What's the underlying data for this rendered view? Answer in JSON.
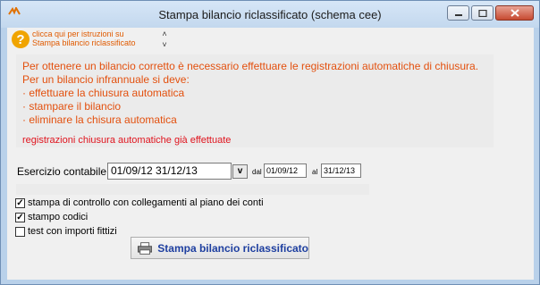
{
  "window": {
    "title": "Stampa bilancio riclassificato (schema cee)"
  },
  "help": {
    "line1": "clicca qui per istruzioni su",
    "line2": "Stampa bilancio riclassificato",
    "icon": "question-icon"
  },
  "notice": {
    "line1": "Per ottenere un bilancio corretto è necessario effettuare le registrazioni automatiche di chiusura.",
    "line2": "Per un bilancio infrannuale si deve:",
    "line3": "· effettuare la chiusura automatica",
    "line4": "· stampare il bilancio",
    "line5": "· eliminare la chisura automatica",
    "status": "registrazioni chiusura automatiche già effettuate"
  },
  "esercizio": {
    "label": "Esercizio contabile",
    "value": "01/09/12 31/12/13",
    "button": "v",
    "dal_label": "dal",
    "dal_value": "01/09/12",
    "al_label": "al",
    "al_value": "31/12/13"
  },
  "options": [
    {
      "label": "stampa di controllo con collegamenti al piano dei conti",
      "checked": true
    },
    {
      "label": "stampo codici",
      "checked": true
    },
    {
      "label": "test con importi fittizi",
      "checked": false
    }
  ],
  "print_button": {
    "label": "Stampa bilancio riclassificato",
    "icon": "printer-icon"
  },
  "colors": {
    "notice_text": "#e3500e",
    "status_text": "#e0141e",
    "button_text": "#1e3fa0",
    "help_text": "#e05a00"
  }
}
